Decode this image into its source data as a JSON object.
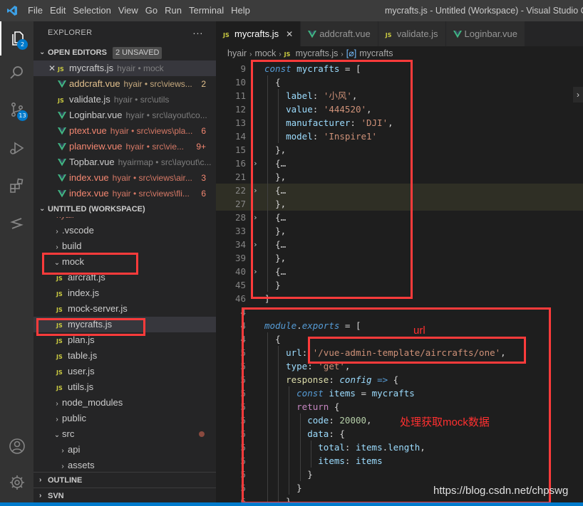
{
  "titlebar": {
    "menus": [
      "File",
      "Edit",
      "Selection",
      "View",
      "Go",
      "Run",
      "Terminal",
      "Help"
    ],
    "window_title": "mycrafts.js - Untitled (Workspace) - Visual Studio Code"
  },
  "activity": {
    "explorer_badge": "2",
    "scm_badge": "13"
  },
  "sidebar": {
    "title": "EXPLORER",
    "more": "···",
    "open_editors_label": "OPEN EDITORS",
    "unsaved_label": "2 UNSAVED",
    "open_editors": [
      {
        "kind": "js",
        "name": "mycrafts.js",
        "desc": "hyair • mock",
        "count": ""
      },
      {
        "kind": "vue",
        "name": "addcraft.vue",
        "desc": "hyair • src\\views...",
        "count": "2"
      },
      {
        "kind": "js",
        "name": "validate.js",
        "desc": "hyair • src\\utils",
        "count": ""
      },
      {
        "kind": "vue",
        "name": "Loginbar.vue",
        "desc": "hyair • src\\layout\\co...",
        "count": ""
      },
      {
        "kind": "vue",
        "name": "ptext.vue",
        "desc": "hyair • src\\views\\pla...",
        "count": "6"
      },
      {
        "kind": "vue",
        "name": "planview.vue",
        "desc": "hyair • src\\vie...",
        "count": "9+"
      },
      {
        "kind": "vue",
        "name": "Topbar.vue",
        "desc": "hyairmap • src\\layout\\c...",
        "count": ""
      },
      {
        "kind": "vue",
        "name": "index.vue",
        "desc": "hyair • src\\views\\air...",
        "count": "3"
      },
      {
        "kind": "vue",
        "name": "index.vue",
        "desc": "hyair • src\\views\\fli...",
        "count": "6"
      }
    ],
    "workspace_label": "UNTITLED (WORKSPACE)",
    "tree_partial": "hyair",
    "tree": [
      {
        "type": "folder",
        "name": ".vscode",
        "open": false
      },
      {
        "type": "folder",
        "name": "build",
        "open": false
      },
      {
        "type": "folder",
        "name": "mock",
        "open": true
      },
      {
        "type": "js",
        "name": "aircraft.js"
      },
      {
        "type": "js",
        "name": "index.js"
      },
      {
        "type": "js",
        "name": "mock-server.js"
      },
      {
        "type": "js",
        "name": "mycrafts.js"
      },
      {
        "type": "js",
        "name": "plan.js"
      },
      {
        "type": "js",
        "name": "table.js"
      },
      {
        "type": "js",
        "name": "user.js"
      },
      {
        "type": "js",
        "name": "utils.js"
      },
      {
        "type": "folder",
        "name": "node_modules",
        "open": false
      },
      {
        "type": "folder",
        "name": "public",
        "open": false
      },
      {
        "type": "folder",
        "name": "src",
        "open": true
      },
      {
        "type": "folder",
        "name": "api",
        "open": false
      },
      {
        "type": "folder",
        "name": "assets",
        "open": false
      }
    ],
    "outline_label": "OUTLINE",
    "svn_label": "SVN"
  },
  "tabs": [
    {
      "kind": "js",
      "label": "mycrafts.js",
      "active": true
    },
    {
      "kind": "vue",
      "label": "addcraft.vue",
      "active": false
    },
    {
      "kind": "js",
      "label": "validate.js",
      "active": false
    },
    {
      "kind": "vue",
      "label": "Loginbar.vue",
      "active": false
    }
  ],
  "breadcrumb": [
    "hyair",
    "mock",
    "mycrafts.js",
    "mycrafts"
  ],
  "code_lines": [
    {
      "n": "9",
      "text": "const mycrafts = ["
    },
    {
      "n": "10",
      "text": "  {"
    },
    {
      "n": "11",
      "text": "    label: '小风',"
    },
    {
      "n": "12",
      "text": "    value: '444520',"
    },
    {
      "n": "13",
      "text": "    manufacturer: 'DJI',"
    },
    {
      "n": "14",
      "text": "    model: 'Inspire1'"
    },
    {
      "n": "15",
      "text": "  },"
    },
    {
      "n": "16",
      "text": "  {…"
    },
    {
      "n": "21",
      "text": "  },"
    },
    {
      "n": "22",
      "text": "  {…"
    },
    {
      "n": "27",
      "text": "  },"
    },
    {
      "n": "28",
      "text": "  {…"
    },
    {
      "n": "33",
      "text": "  },"
    },
    {
      "n": "34",
      "text": "  {…"
    },
    {
      "n": "39",
      "text": "  },"
    },
    {
      "n": "40",
      "text": "  {…"
    },
    {
      "n": "45",
      "text": "  }"
    },
    {
      "n": "46",
      "text": "]"
    },
    {
      "n": "4",
      "text": ""
    },
    {
      "n": "4",
      "text": "module.exports = ["
    },
    {
      "n": "4",
      "text": "  {"
    },
    {
      "n": "5",
      "text": "    url: '/vue-admin-template/aircrafts/one',"
    },
    {
      "n": "5",
      "text": "    type: 'get',"
    },
    {
      "n": "5",
      "text": "    response: config => {"
    },
    {
      "n": "5",
      "text": "      const items = mycrafts"
    },
    {
      "n": "5",
      "text": "      return {"
    },
    {
      "n": "5",
      "text": "        code: 20000,"
    },
    {
      "n": "5",
      "text": "        data: {"
    },
    {
      "n": "5",
      "text": "          total: items.length,"
    },
    {
      "n": "5",
      "text": "          items: items"
    },
    {
      "n": "5",
      "text": "        }"
    },
    {
      "n": "5",
      "text": "      }"
    },
    {
      "n": "6",
      "text": "    }"
    }
  ],
  "annotations": {
    "url_label": "url",
    "mock_label": "处理获取mock数据",
    "watermark": "https://blog.csdn.net/chpswg"
  },
  "colors": {
    "annotation_red": "#ff3b3b",
    "accent_blue": "#007acc",
    "vue_green": "#41b883",
    "js_yellow": "#cbcb41"
  }
}
